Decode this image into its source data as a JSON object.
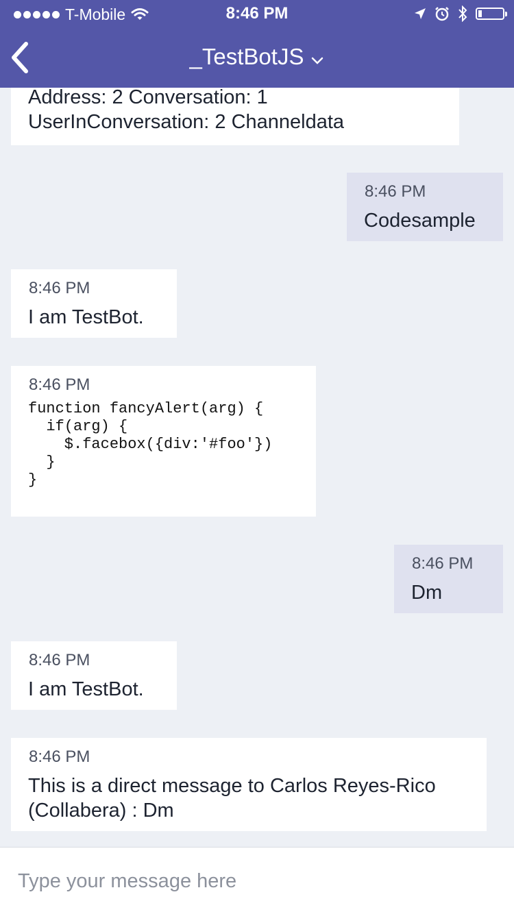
{
  "status_bar": {
    "carrier": "T-Mobile",
    "time": "8:46 PM",
    "icons": [
      "signal-dots-icon",
      "wifi-icon",
      "location-arrow-icon",
      "alarm-icon",
      "bluetooth-icon",
      "battery-icon"
    ],
    "battery_level": 0.1
  },
  "nav": {
    "back_icon": "chevron-left-icon",
    "title": "_TestBotJS",
    "title_icon": "chevron-down-icon"
  },
  "colors": {
    "header_bg": "#5457a8",
    "chat_bg": "#edf0f5",
    "bot_bubble": "#ffffff",
    "user_bubble": "#dfe1ef"
  },
  "messages": [
    {
      "sender": "bot",
      "timestamp": "",
      "text": "Address: 2 Conversation: 1\nUserInConversation: 2 Channeldata"
    },
    {
      "sender": "user",
      "timestamp": "8:46 PM",
      "text": "Codesample"
    },
    {
      "sender": "bot",
      "timestamp": "8:46 PM",
      "text": "I am TestBot."
    },
    {
      "sender": "bot",
      "timestamp": "8:46 PM",
      "code": "function fancyAlert(arg) {\n  if(arg) {\n    $.facebox({div:'#foo'})\n  }\n}"
    },
    {
      "sender": "user",
      "timestamp": "8:46 PM",
      "text": "Dm"
    },
    {
      "sender": "bot",
      "timestamp": "8:46 PM",
      "text": "I am TestBot."
    },
    {
      "sender": "bot",
      "timestamp": "8:46 PM",
      "text": "This is a direct message to Carlos Reyes-Rico\n(Collabera) : Dm"
    }
  ],
  "composer": {
    "placeholder": "Type your message here",
    "value": ""
  }
}
